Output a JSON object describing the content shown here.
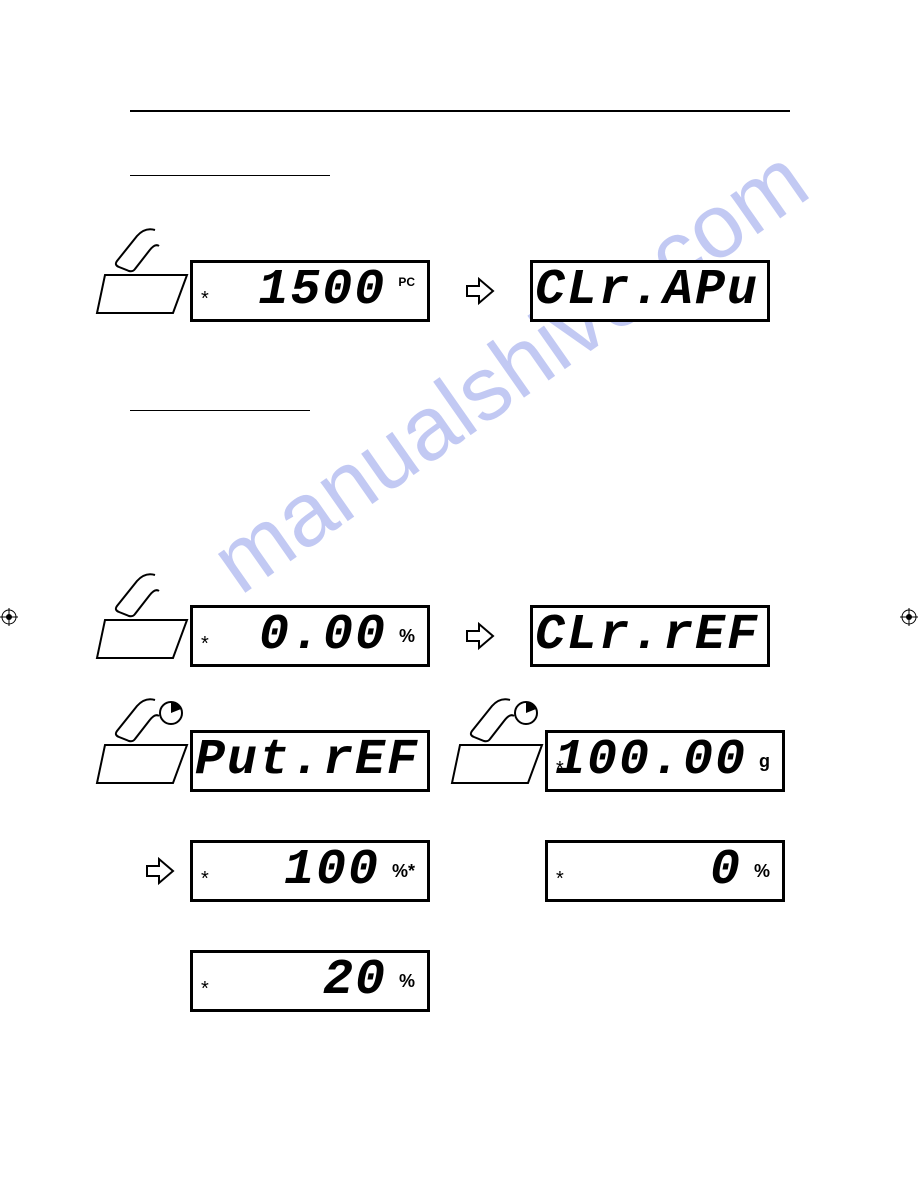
{
  "watermark": "manualshive.com",
  "lcd": {
    "d1": {
      "value": "1500",
      "unit": "PC"
    },
    "d2": {
      "value": "CLr.APu"
    },
    "d3": {
      "value": "0.00",
      "unit": "%"
    },
    "d4": {
      "value": "CLr.rEF"
    },
    "d5": {
      "value": "Put.rEF"
    },
    "d6": {
      "value": "100.00",
      "unit": "g"
    },
    "d7": {
      "value": "100",
      "unit": "%*"
    },
    "d8": {
      "value": "0",
      "unit": "%"
    },
    "d9": {
      "value": "20",
      "unit": "%"
    }
  }
}
